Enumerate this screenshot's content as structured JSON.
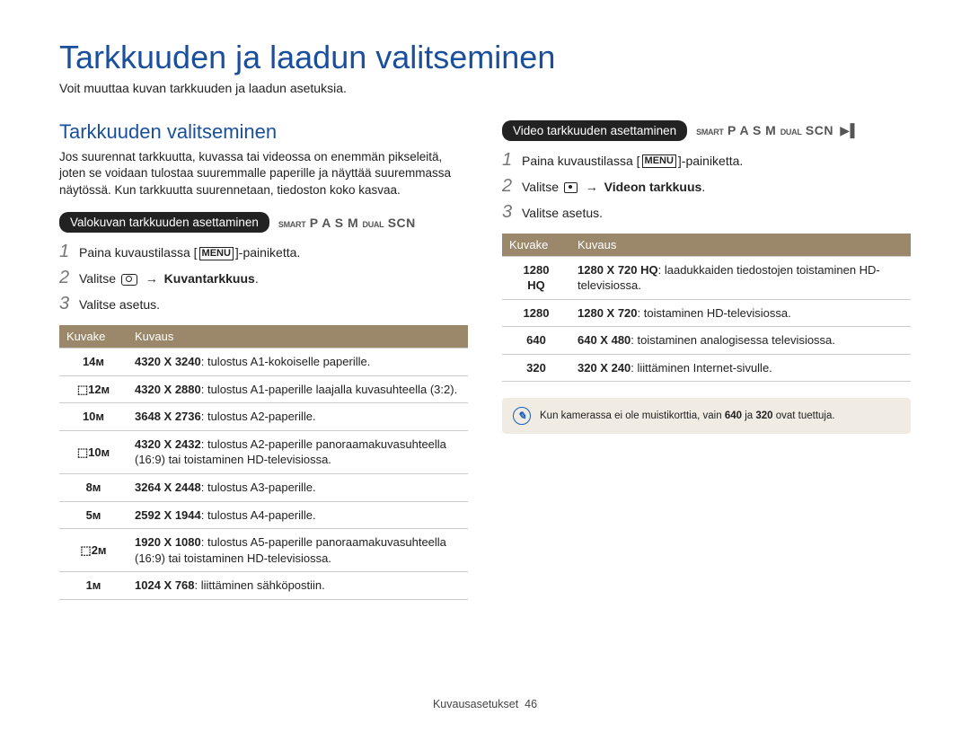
{
  "page_title": "Tarkkuuden ja laadun valitseminen",
  "page_subtitle": "Voit muuttaa kuvan tarkkuuden ja laadun asetuksia.",
  "left": {
    "section_title": "Tarkkuuden valitseminen",
    "section_text": "Jos suurennat tarkkuutta, kuvassa tai videossa on enemmän pikseleitä, joten se voidaan tulostaa suuremmalle paperille ja näyttää suuremmassa näytössä. Kun tarkkuutta suurennetaan, tiedoston koko kasvaa.",
    "pill_label": "Valokuvan tarkkuuden asettaminen",
    "mode_hint": "P A S M",
    "mode_smart": "SMART",
    "mode_dual": "DUAL",
    "mode_scn": "SCN",
    "steps": [
      {
        "n": "1",
        "pre": "Paina kuvaustilassa [",
        "menu": "MENU",
        "post": "]-painiketta."
      },
      {
        "n": "2",
        "pre": "Valitse ",
        "icon": "camera",
        "arrow": "→",
        "bold": " Kuvantarkkuus",
        "post": "."
      },
      {
        "n": "3",
        "pre": "Valitse asetus."
      }
    ],
    "table_headers": [
      "Kuvake",
      "Kuvaus"
    ],
    "rows": [
      {
        "icon": "14m",
        "res": "4320 X 3240",
        "desc": ": tulostus A1-kokoiselle paperille."
      },
      {
        "icon": "12mw",
        "res": "4320 X 2880",
        "desc": ": tulostus A1-paperille laajalla kuvasuhteella (3:2)."
      },
      {
        "icon": "10m",
        "res": "3648 X 2736",
        "desc": ": tulostus A2-paperille."
      },
      {
        "icon": "10mw",
        "res": "4320 X 2432",
        "desc": ": tulostus A2-paperille panoraamakuvasuhteella (16:9) tai toistaminen HD-televisiossa."
      },
      {
        "icon": "8m",
        "res": "3264 X 2448",
        "desc": ": tulostus A3-paperille."
      },
      {
        "icon": "5m",
        "res": "2592 X 1944",
        "desc": ": tulostus A4-paperille."
      },
      {
        "icon": "2mw",
        "res": "1920 X 1080",
        "desc": ": tulostus A5-paperille panoraamakuvasuhteella (16:9) tai toistaminen HD-televisiossa."
      },
      {
        "icon": "1m",
        "res": "1024 X 768",
        "desc": ": liittäminen sähköpostiin."
      }
    ]
  },
  "right": {
    "pill_label": "Video tarkkuuden asettaminen",
    "mode_hint": "P A S M",
    "mode_smart": "SMART",
    "mode_dual": "DUAL",
    "mode_scn": "SCN",
    "steps": [
      {
        "n": "1",
        "pre": "Paina kuvaustilassa [",
        "menu": "MENU",
        "post": "]-painiketta."
      },
      {
        "n": "2",
        "pre": "Valitse ",
        "icon": "video",
        "arrow": "→",
        "bold": " Videon tarkkuus",
        "post": "."
      },
      {
        "n": "3",
        "pre": "Valitse asetus."
      }
    ],
    "table_headers": [
      "Kuvake",
      "Kuvaus"
    ],
    "rows": [
      {
        "icon": "1280HQ",
        "res": "1280 X 720 HQ",
        "desc": ": laadukkaiden tiedostojen toistaminen HD-televisiossa."
      },
      {
        "icon": "1280",
        "res": "1280 X 720",
        "desc": ": toistaminen HD-televisiossa."
      },
      {
        "icon": "640",
        "res": "640 X 480",
        "desc": ": toistaminen analogisessa televisiossa."
      },
      {
        "icon": "320",
        "res": "320 X 240",
        "desc": ": liittäminen Internet-sivulle."
      }
    ],
    "note": {
      "pre": "Kun kamerassa ei ole muistikorttia, vain ",
      "i1": "640",
      "mid": " ja ",
      "i2": "320",
      "post": " ovat tuettuja."
    }
  },
  "footer": {
    "section": "Kuvausasetukset",
    "page": "46"
  }
}
